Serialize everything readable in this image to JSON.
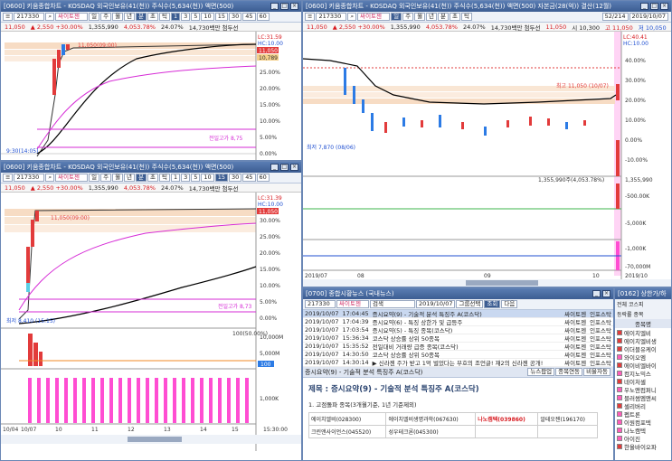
{
  "chart1": {
    "title": "[0600] 키움종합차트 - KOSDAQ 외국인보유(41(천)) 주식수(5,634(천)) 액면(500)",
    "code": "217330",
    "name": "싸이토젠",
    "tabs": [
      "일",
      "주",
      "월",
      "년",
      "분",
      "초",
      "틱"
    ],
    "intervals": [
      "1",
      "3",
      "5",
      "10",
      "15",
      "30",
      "45",
      "60",
      "5"
    ],
    "info": {
      "price": "11,050",
      "change": "▲ 2,550 +30.00%",
      "volume": "1,355,990",
      "amount": "4,053.78%",
      "ratio": "24.07%",
      "cap": "14,730백만 첨두선"
    },
    "labels": {
      "high": "11,050(09:00)",
      "low": "9:30(14:05)",
      "prev": "전일고가 8,75",
      "lc": "LC:31.59",
      "hc": "HC:10.00",
      "p1": "11,050",
      "p2": "10,789"
    },
    "y_ticks": [
      "25.00%",
      "20.00%",
      "15.00%",
      "10.00%",
      "5.00%",
      "0.00%"
    ]
  },
  "chart2": {
    "title": "[0600] 키움종합차트 - KOSDAQ 외국인보유(41(천)) 주식수(5,634(천)) 액면(500)",
    "code": "217330",
    "name": "싸이토젠",
    "tabs": [
      "일",
      "주",
      "월",
      "년",
      "분",
      "초",
      "틱"
    ],
    "intervals": [
      "1",
      "3",
      "5",
      "10",
      "15",
      "30",
      "45",
      "60",
      "5"
    ],
    "info": {
      "price": "11,050",
      "change": "▲ 2,550 +30.00%",
      "volume": "1,355,990",
      "amount": "4,053.78%",
      "ratio": "24.07%",
      "cap": "14,730백만 첨두선"
    },
    "labels": {
      "high": "11,050(09:00)",
      "low": "최저 8,410 (15:15)",
      "prev": "전일고가 8,73",
      "lc": "LC:31.39",
      "hc": "HC:10.00",
      "p1": "11,050",
      "vol": "100(50.00%)",
      "macd": "100"
    },
    "y_ticks": [
      "30.00%",
      "25.00%",
      "20.00%",
      "15.00%",
      "10.00%",
      "5.00%",
      "0.00%"
    ],
    "vol_ticks": [
      "10,000M",
      "5,000M",
      "1,000K"
    ],
    "x_labels": [
      "10/04",
      "10/07",
      "10",
      "11",
      "12",
      "13",
      "14",
      "15",
      "15:30:00"
    ]
  },
  "chart3": {
    "title": "[0600] 키움종합차트 - KOSDAQ 외국인보유(41(천)) 주식수(5,634(천)) 액면(500) 자본금(28(억)) 결산(12월)",
    "code": "217330",
    "name": "싸이토젠",
    "tabs": [
      "일",
      "주",
      "월",
      "년",
      "분",
      "초",
      "틱"
    ],
    "page": "52/214",
    "date": "2019/10/07",
    "info": {
      "price": "11,050",
      "change": "▲ 2,550 +30.00%",
      "volume": "1,355,990",
      "amount": "4,053.78%",
      "ratio": "24.07%",
      "cap": "14,730백만 첨두선",
      "high": "11,050",
      "open": "시 10,300",
      "high2": "고 11,050",
      "low2": "저 10,050"
    },
    "labels": {
      "high": "최고 11,050 (10/07)",
      "low": "최저 7,870 (08/06)",
      "vol": "1,355,990주(4,053.78%)",
      "lc": "LC:40.41",
      "hc": "HC:10.00"
    },
    "y_ticks": [
      "40.00%",
      "30.00%",
      "20.00%",
      "10.00%",
      "0.00%",
      "-10.00%"
    ],
    "vol_ticks": [
      "1,355,990",
      "-500.00K"
    ],
    "ind_ticks": [
      "-5,000K",
      "-1,000K",
      "-70,000M"
    ],
    "x_labels": [
      "2019/07",
      "08",
      "09",
      "10",
      "2019/10"
    ]
  },
  "news": {
    "title": "[0700] 종합시황뉴스 (국내뉴스)",
    "code": "217330",
    "name": "싸이토젠",
    "search": "검색",
    "date": "2019/10/07",
    "group": "그룹선택",
    "query": "조회",
    "next": "다음",
    "rows": [
      {
        "date": "2019/10/07",
        "time": "17:04:45",
        "title": "증시요약(9) - 기술적 분석 특징주 A(코스닥)",
        "src1": "싸이토젠",
        "src2": "인포스탁"
      },
      {
        "date": "2019/10/07",
        "time": "17:04:39",
        "title": "증시요약(6) - 특징 상한가 및 급등주",
        "src1": "싸이토젠",
        "src2": "인포스탁"
      },
      {
        "date": "2019/10/07",
        "time": "17:03:54",
        "title": "증시요약(5) - 특징 종목(코스닥)",
        "src1": "싸이토젠",
        "src2": "인포스탁"
      },
      {
        "date": "2019/10/07",
        "time": "15:36:34",
        "title": "코스닥 상승률 상위 50종목",
        "src1": "싸이토젠",
        "src2": "인포스탁"
      },
      {
        "date": "2019/10/07",
        "time": "15:35:52",
        "title": "전일대비 거래량 급증 종목(코스닥)",
        "src1": "싸이토젠",
        "src2": "인포스탁"
      },
      {
        "date": "2019/10/07",
        "time": "14:30:50",
        "title": "코스닥 상승률 상위 50종목",
        "src1": "싸이토젠",
        "src2": "인포스탁"
      },
      {
        "date": "2019/10/07",
        "time": "14:30:14",
        "title": "▶ 신라젠 주가 받고 1억 벌었다는 부호의 조언글! 재2의 신라젠 공개!",
        "src1": "싸이토젠",
        "src2": "인포스탁"
      }
    ],
    "detail_title_bar": "증시요약(9) - 기술적 분석 특징주 A(코스닥)",
    "checkboxes": [
      "뉴스팝업",
      "종목연동",
      "비율자동"
    ],
    "heading": "제목 : 증시요약(9) - 기술적 분석 특징주 A(코스닥)",
    "subheading": "1. 고점돌파 종목(3개월기준, 1년 기준제외)",
    "table": [
      [
        "에이치엘비(028300)",
        "에이치엘비생명과학(067630)",
        "나노캠텍(039860)",
        "알테오젠(196170)"
      ],
      [
        "크린앤사이언스(045520)",
        "성우테크론(045300)",
        "",
        ""
      ]
    ]
  },
  "watch": {
    "title": "[0162] 상한가/하",
    "options": [
      "전체",
      "코스피",
      "코",
      "등락률",
      "종목"
    ],
    "header": "종목명",
    "items": [
      {
        "name": "에이치엘비",
        "color": "#e23b3b"
      },
      {
        "name": "에이치엘비생",
        "color": "#e23b3b"
      },
      {
        "name": "이더블유케이",
        "color": "#e23b3b"
      },
      {
        "name": "와이오엠",
        "color": "#ff5cbb"
      },
      {
        "name": "에이비엘바이",
        "color": "#e23b3b"
      },
      {
        "name": "컴지노믹스",
        "color": "#ff5cbb"
      },
      {
        "name": "네이처셀",
        "color": "#e23b3b"
      },
      {
        "name": "우노앤컴퍼니",
        "color": "#ff5cbb"
      },
      {
        "name": "블러썸엠앤씨",
        "color": "#ff5cbb"
      },
      {
        "name": "셀리버리",
        "color": "#e23b3b"
      },
      {
        "name": "펩트론",
        "color": "#ff5cbb"
      },
      {
        "name": "이원컴포텍",
        "color": "#ff5cbb"
      },
      {
        "name": "나노캠텍",
        "color": "#ff5cbb"
      },
      {
        "name": "아이진",
        "color": "#ff5cbb"
      },
      {
        "name": "한올바이오파",
        "color": "#e23b3b"
      }
    ]
  }
}
